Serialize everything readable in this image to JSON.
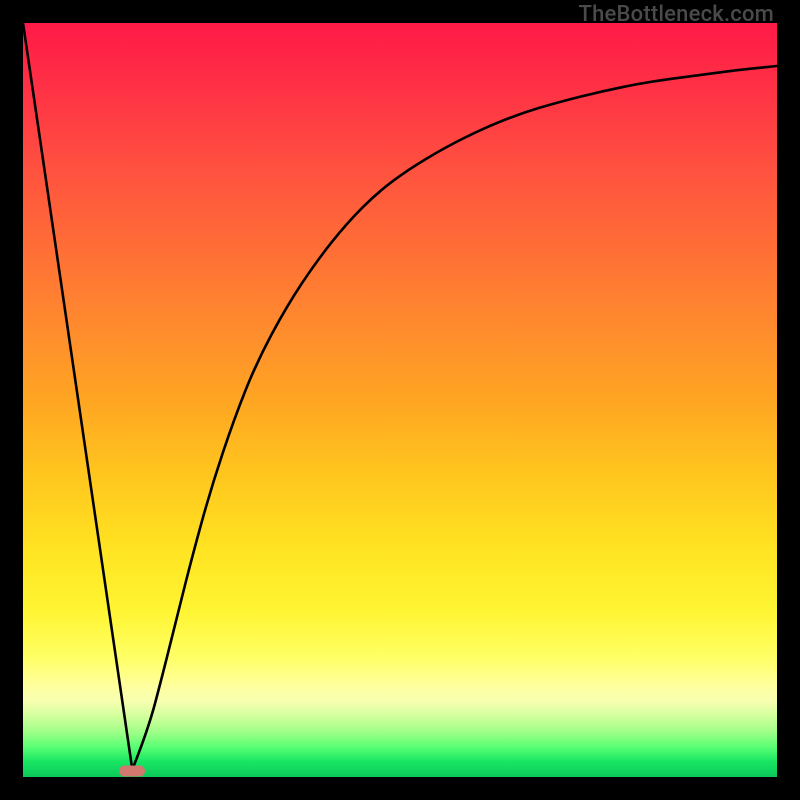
{
  "watermark": "TheBottleneck.com",
  "colors": {
    "curve": "#000000",
    "marker": "#d1786f",
    "frame": "#000000"
  },
  "chart_data": {
    "type": "line",
    "title": "",
    "xlabel": "",
    "ylabel": "",
    "xlim": [
      0,
      1
    ],
    "ylim": [
      0,
      1
    ],
    "grid": false,
    "axes_visible": false,
    "series": [
      {
        "name": "left-line",
        "x": [
          0.0,
          0.145
        ],
        "values": [
          1.0,
          0.01
        ]
      },
      {
        "name": "right-curve",
        "x": [
          0.145,
          0.165,
          0.185,
          0.205,
          0.225,
          0.25,
          0.28,
          0.31,
          0.35,
          0.39,
          0.43,
          0.47,
          0.51,
          0.56,
          0.61,
          0.66,
          0.71,
          0.77,
          0.83,
          0.89,
          0.95,
          1.0
        ],
        "values": [
          0.01,
          0.06,
          0.135,
          0.215,
          0.295,
          0.385,
          0.475,
          0.55,
          0.625,
          0.685,
          0.735,
          0.775,
          0.805,
          0.835,
          0.86,
          0.88,
          0.895,
          0.91,
          0.922,
          0.93,
          0.938,
          0.943
        ]
      }
    ],
    "marker": {
      "x": 0.145,
      "y": 0.008
    }
  }
}
